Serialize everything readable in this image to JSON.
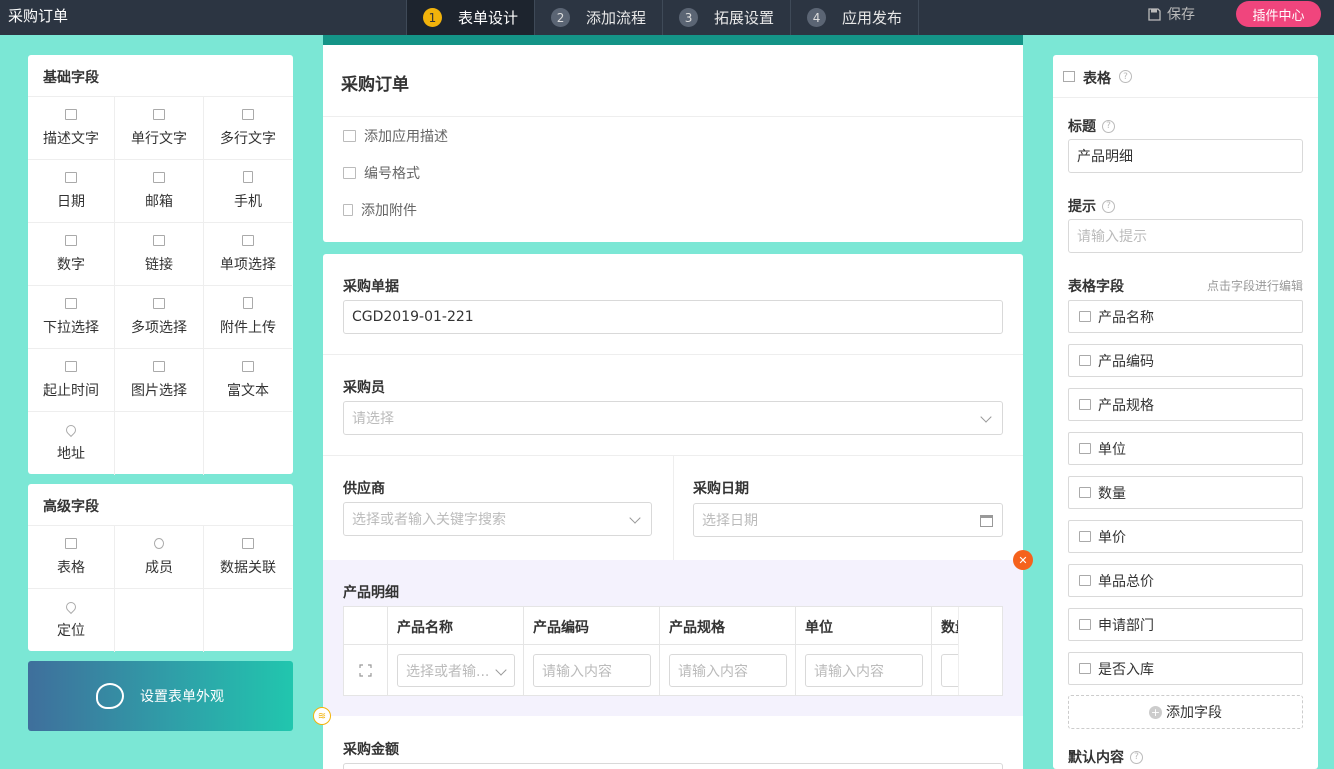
{
  "app": {
    "title": "采购订单",
    "steps": [
      {
        "num": "1",
        "label": "表单设计"
      },
      {
        "num": "2",
        "label": "添加流程"
      },
      {
        "num": "3",
        "label": "拓展设置"
      },
      {
        "num": "4",
        "label": "应用发布"
      }
    ],
    "save_label": "保存",
    "plugin_label": "插件中心"
  },
  "basic": {
    "title": "基础字段",
    "items": [
      "描述文字",
      "单行文字",
      "多行文字",
      "日期",
      "邮箱",
      "手机",
      "数字",
      "链接",
      "单项选择",
      "下拉选择",
      "多项选择",
      "附件上传",
      "起止时间",
      "图片选择",
      "富文本",
      "地址"
    ]
  },
  "advanced": {
    "title": "高级字段",
    "items": [
      "表格",
      "成员",
      "数据关联",
      "定位"
    ]
  },
  "appearance_label": "设置表单外观",
  "form": {
    "title": "采购订单",
    "head_items": [
      "添加应用描述",
      "编号格式",
      "添加附件"
    ],
    "order_no": {
      "label": "采购单据",
      "value": "CGD2019-01-221"
    },
    "buyer": {
      "label": "采购员",
      "placeholder": "请选择"
    },
    "supplier": {
      "label": "供应商",
      "placeholder": "选择或者输入关键字搜索"
    },
    "date": {
      "label": "采购日期",
      "placeholder": "选择日期"
    },
    "detail": {
      "label": "产品明细",
      "columns": [
        "产品名称",
        "产品编码",
        "产品规格",
        "单位",
        "数量"
      ],
      "row": [
        "选择或者输...",
        "请输入内容",
        "请输入内容",
        "请输入内容"
      ]
    },
    "amount": {
      "label": "采购金额"
    }
  },
  "props": {
    "type_label": "表格",
    "title_label": "标题",
    "title_value": "产品明细",
    "hint_label": "提示",
    "hint_placeholder": "请输入提示",
    "fields_label": "表格字段",
    "fields_hint": "点击字段进行编辑",
    "fields": [
      "产品名称",
      "产品编码",
      "产品规格",
      "单位",
      "数量",
      "单价",
      "单品总价",
      "申请部门",
      "是否入库"
    ],
    "add_field": "添加字段",
    "default_label": "默认内容"
  }
}
